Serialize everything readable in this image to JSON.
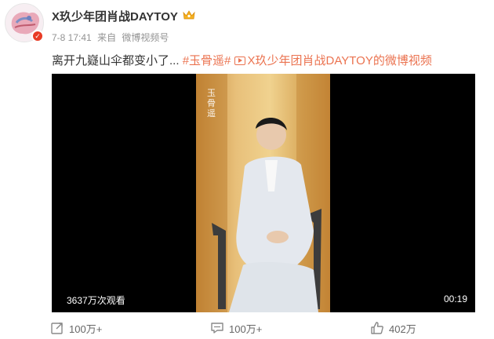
{
  "post": {
    "user_name": "X玖少年团肖战DAYTOY",
    "date": "7-8 17:41",
    "source_prefix": "来自",
    "source": "微博视频号",
    "text_main": "离开九嶷山伞都变小了...",
    "topic": "#玉骨遥#",
    "video_link_label": "X玖少年团肖战DAYTOY的微博视频"
  },
  "video": {
    "play_count": "3637万次观看",
    "duration": "00:19",
    "watermark": "玉骨遥"
  },
  "actions": {
    "repost": "100万+",
    "comment": "100万+",
    "like": "402万"
  },
  "colors": {
    "link_orange": "#eb7350",
    "text_dark": "#333333",
    "meta_gray": "#939393",
    "badge_red": "#e83b25"
  },
  "icons": {
    "avatar": "avatar",
    "verified": "verified-badge-icon",
    "crown": "crown-icon",
    "video_link": "video-link-icon",
    "repost": "repost-icon",
    "comment": "comment-icon",
    "like": "thumbs-up-icon"
  }
}
